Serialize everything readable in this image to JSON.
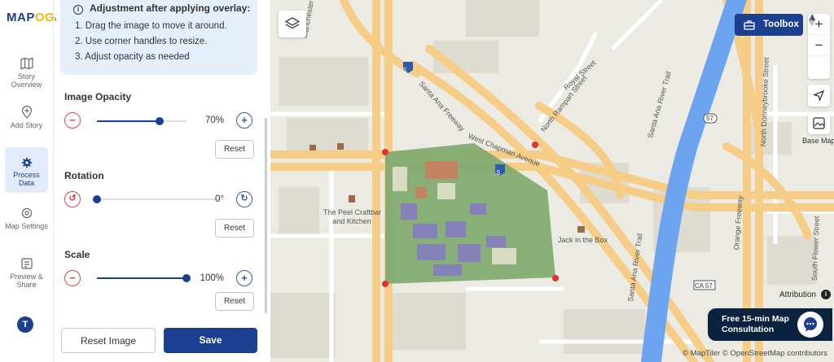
{
  "app": {
    "logo_main": "MAP",
    "logo_accent": "OG"
  },
  "rail": {
    "items": [
      {
        "label": "Story Overview",
        "icon": "map-icon"
      },
      {
        "label": "Add Story",
        "icon": "add-location-icon"
      },
      {
        "label": "Process Data",
        "icon": "gear-icon",
        "active": true
      },
      {
        "label": "Map Settings",
        "icon": "settings-icon"
      },
      {
        "label": "Preview & Share",
        "icon": "share-icon"
      }
    ],
    "avatar_initial": "T",
    "collapse_glyph": "›"
  },
  "info": {
    "title": "Adjustment after applying overlay:",
    "steps": [
      "1. Drag the image to move it around.",
      "2. Use corner handles to resize.",
      "3. Adjust opacity as needed"
    ]
  },
  "controls": {
    "opacity": {
      "title": "Image Opacity",
      "value_text": "70%",
      "fraction": 0.7,
      "reset": "Reset"
    },
    "rotation": {
      "title": "Rotation",
      "value_text": "0°",
      "fraction": 0.0,
      "reset": "Reset"
    },
    "scale": {
      "title": "Scale",
      "value_text": "100%",
      "fraction": 1.0,
      "reset": "Reset"
    },
    "minus_glyph": "−",
    "plus_glyph": "+"
  },
  "actions": {
    "reset_image": "Reset Image",
    "save": "Save"
  },
  "map": {
    "toolbox": "Toolbox",
    "zoom_in": "+",
    "zoom_out": "−",
    "base_map": "Base Map",
    "labels": {
      "santa_ana_freeway": "Santa Ana Freeway",
      "west_chapman": "West Chapman Avenue",
      "royal_street": "Royal Street",
      "north_rampart": "North Rampart Street",
      "santa_ana_river_trail": "Santa Ana River Trail",
      "santa_ana_river_trail_2": "Santa Ana River Trail",
      "north_donnybrooke": "North Donneybrooke Street",
      "orange_freeway": "Orange Freeway",
      "south_flower": "South Flower Street",
      "manchester": "Manchester Avenue",
      "peel_craftbar_line1": "The Peel Craftbar",
      "peel_craftbar_line2": "and Kitchen",
      "jack_in_the_box": "Jack in the Box",
      "shield_5a": "5",
      "shield_5b": "5",
      "shield_57": "57",
      "ca57": "CA 57"
    },
    "attribution": "Attribution",
    "copyright": "© MapTiler © OpenStreetMap contributors",
    "consult_line1": "Free 15-min Map",
    "consult_line2": "Consultation",
    "colors": {
      "accent": "#1d3f8f",
      "danger": "#d9434b",
      "river": "#6da4ef",
      "freeway": "#f6cd87"
    }
  }
}
